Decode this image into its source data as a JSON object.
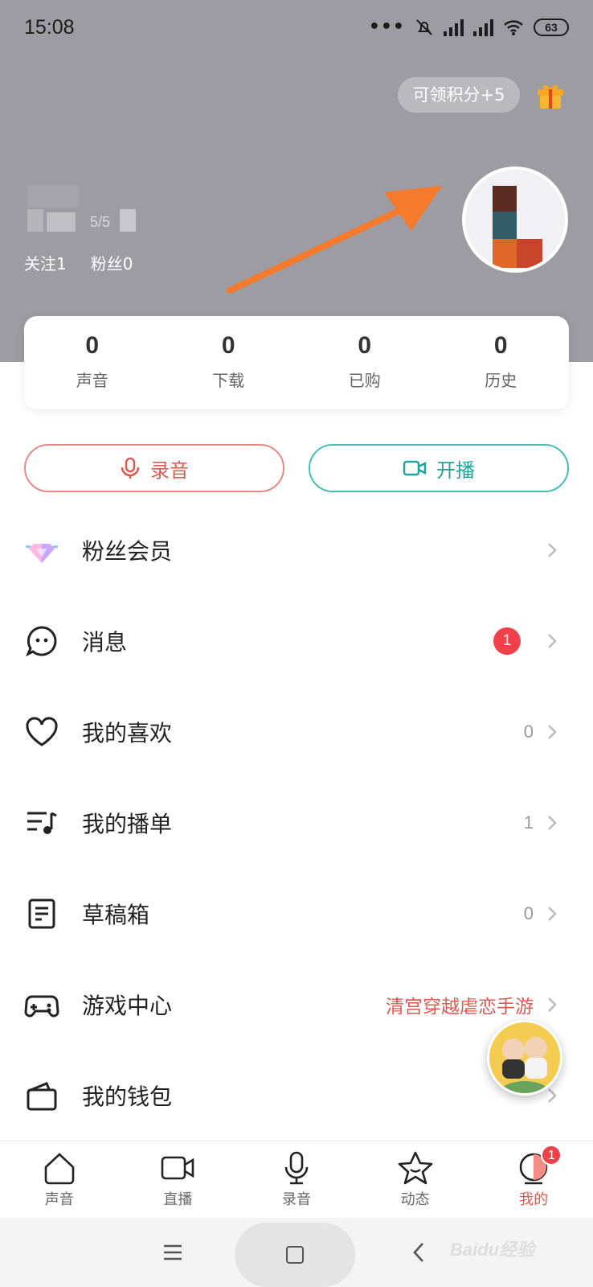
{
  "status_bar": {
    "time": "15:08",
    "battery": "63"
  },
  "header": {
    "points_label": "可领积分+5",
    "user_id_partial": "5/5"
  },
  "follow": {
    "following": "关注1",
    "fans": "粉丝0"
  },
  "stats": [
    {
      "value": "0",
      "label": "声音"
    },
    {
      "value": "0",
      "label": "下载"
    },
    {
      "value": "0",
      "label": "已购"
    },
    {
      "value": "0",
      "label": "历史"
    }
  ],
  "actions": {
    "record": "录音",
    "live": "开播"
  },
  "menu": [
    {
      "label": "粉丝会员",
      "value": ""
    },
    {
      "label": "消息",
      "value": "",
      "badge": "1"
    },
    {
      "label": "我的喜欢",
      "value": "0"
    },
    {
      "label": "我的播单",
      "value": "1"
    },
    {
      "label": "草稿箱",
      "value": "0"
    },
    {
      "label": "游戏中心",
      "value": "清宫穿越虐恋手游"
    },
    {
      "label": "我的钱包",
      "value": ""
    }
  ],
  "tabs": [
    {
      "label": "声音"
    },
    {
      "label": "直播"
    },
    {
      "label": "录音"
    },
    {
      "label": "动态"
    },
    {
      "label": "我的",
      "badge": "1"
    }
  ],
  "colors": {
    "accent_red": "#e0584f",
    "accent_teal": "#1ea59b",
    "header_gray": "#9c9ca2",
    "arrow_orange": "#f57a2c"
  },
  "watermark": "Baidu经验"
}
